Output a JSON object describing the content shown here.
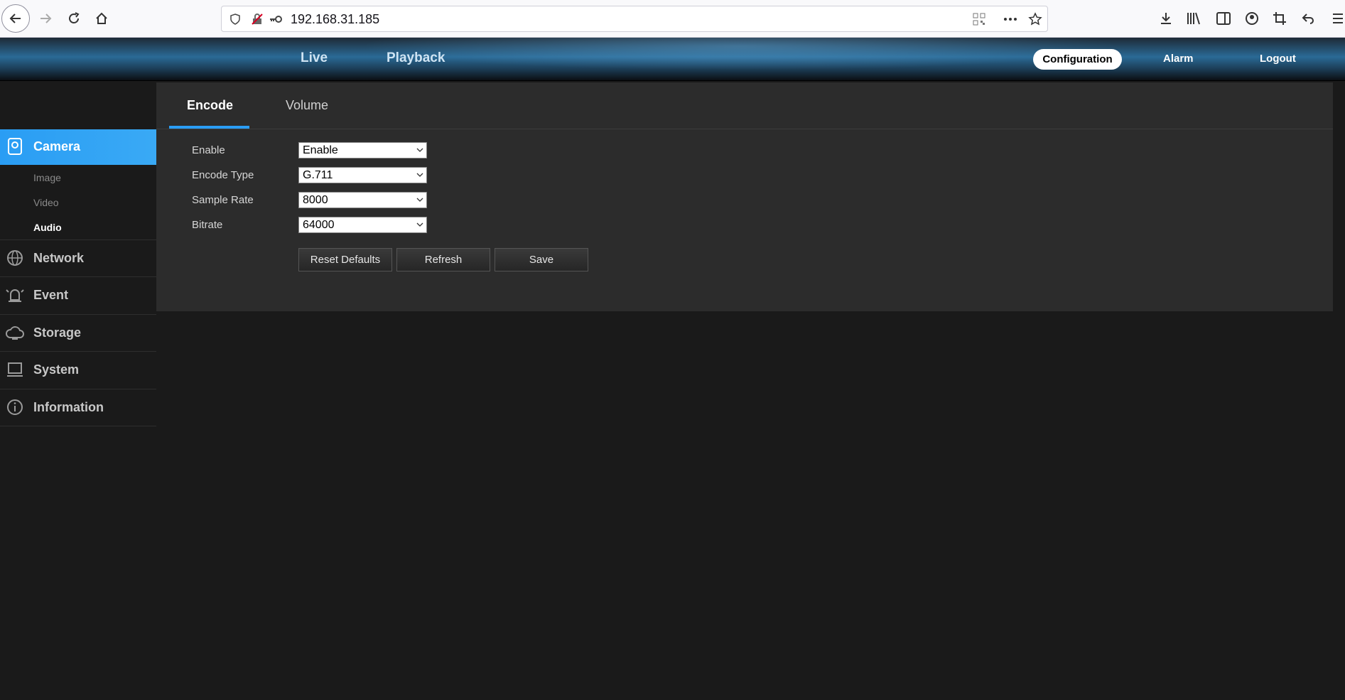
{
  "browser": {
    "url": "192.168.31.185"
  },
  "header": {
    "nav": [
      "Live",
      "Playback"
    ],
    "configuration": "Configuration",
    "alarm": "Alarm",
    "logout": "Logout"
  },
  "sidebar": {
    "camera": "Camera",
    "camera_subs": [
      "Image",
      "Video",
      "Audio"
    ],
    "items": [
      "Network",
      "Event",
      "Storage",
      "System",
      "Information"
    ]
  },
  "tabs": [
    "Encode",
    "Volume"
  ],
  "form": {
    "fields": [
      {
        "label": "Enable",
        "value": "Enable"
      },
      {
        "label": "Encode Type",
        "value": "G.711"
      },
      {
        "label": "Sample Rate",
        "value": "8000"
      },
      {
        "label": "Bitrate",
        "value": "64000"
      }
    ]
  },
  "buttons": {
    "reset": "Reset Defaults",
    "refresh": "Refresh",
    "save": "Save"
  },
  "colors": {
    "accent": "#2a9df4",
    "panel": "#2c2c2c",
    "background": "#1a1a1a"
  }
}
